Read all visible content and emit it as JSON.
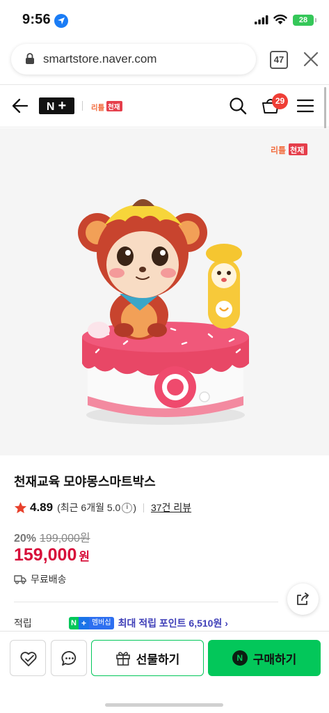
{
  "status_bar": {
    "time": "9:56",
    "battery": "28"
  },
  "browser": {
    "url": "smartstore.naver.com",
    "tab_count": "47"
  },
  "header": {
    "logo_text": "N",
    "store_logo": "리틀천재",
    "cart_count": "29"
  },
  "product": {
    "name": "천재교육 모야몽스마트박스",
    "rating": "4.89",
    "rating_recent_prefix": "(최근 6개월 5.0",
    "rating_recent_suffix": ")",
    "info_mark": "i",
    "review_link": "37건 리뷰",
    "discount_rate": "20%",
    "original_price": "199,000원",
    "sale_price": "159,000",
    "sale_unit": "원",
    "shipping": "무료배송"
  },
  "points": {
    "label": "적립",
    "badge_n": "N",
    "badge_plus": "+",
    "badge_label": "멤버십",
    "text": "최대 적립 포인트 6,510원 ›"
  },
  "actions": {
    "gift_label": "선물하기",
    "buy_label": "구매하기",
    "buy_n": "N"
  },
  "colors": {
    "naver_green": "#03c75a",
    "sale_red": "#d70f3a",
    "badge_red": "#ef3e36",
    "points_blue": "#3f3fb8"
  }
}
